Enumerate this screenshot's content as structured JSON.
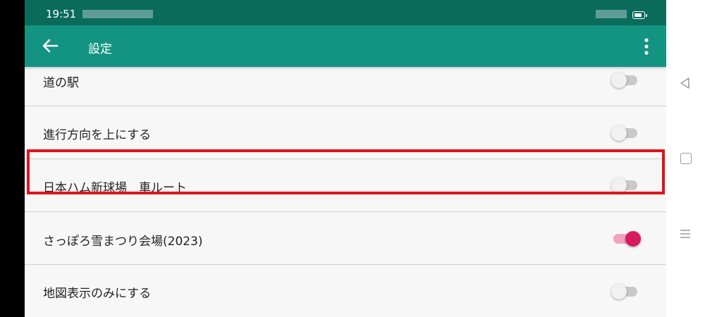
{
  "status_bar": {
    "time": "19:51"
  },
  "app_bar": {
    "title": "設定",
    "back_icon": "arrow-left-icon",
    "menu_icon": "more-vert-icon"
  },
  "settings": [
    {
      "label": "道の駅",
      "enabled": false
    },
    {
      "label": "進行方向を上にする",
      "enabled": false
    },
    {
      "label": "日本ハム新球場　車ルート",
      "enabled": false
    },
    {
      "label": "さっぽろ雪まつり会場(2023)",
      "enabled": true,
      "highlighted": true
    },
    {
      "label": "地図表示のみにする",
      "enabled": false
    }
  ],
  "colors": {
    "status_bar": "#0a6b5b",
    "app_bar": "#139482",
    "switch_on": "#d81b60",
    "switch_on_track": "#f1a3bd",
    "highlight": "#e3121b"
  },
  "nav_bar": {
    "back_icon": "nav-back-triangle-icon",
    "home_icon": "nav-home-square-icon",
    "recent_icon": "nav-recent-lines-icon"
  }
}
